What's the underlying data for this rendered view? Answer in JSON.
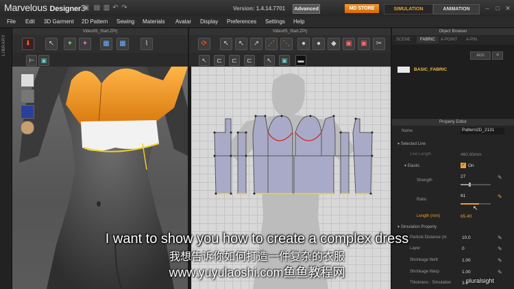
{
  "app": {
    "title_light": "Marvelous",
    "title_bold": "Designer",
    "title_num": "3",
    "version": "Version: 1.4.14.7701",
    "edition": "Advanced",
    "md_store": "MD STORE",
    "simulation": "SIMULATION",
    "animation": "ANIMATION"
  },
  "menu": [
    "File",
    "Edit",
    "3D Garment",
    "2D Pattern",
    "Sewing",
    "Materials",
    "Avatar",
    "Display",
    "Preferences",
    "Settings",
    "Help"
  ],
  "library_label": "LIBRARY",
  "window3d": {
    "title": "Video05_Start.ZPrj"
  },
  "window2d": {
    "title": "Video05_Start.ZPrj"
  },
  "object_browser": {
    "title": "Object Browser",
    "tabs": [
      "SCENE",
      "FABRIC",
      "A-POINT",
      "A-PIN"
    ],
    "active_tab": "FABRIC",
    "add_label": "ADD",
    "fabric_name": "BASIC_FABRIC",
    "fabric_color": "#e8e8e8"
  },
  "property_editor": {
    "title": "Property Editor",
    "name_label": "Name",
    "name_value": "Pattern2D_2131",
    "selected_line": "Selected Line",
    "line_length_label": "Line Length",
    "line_length_value": "460.00mm",
    "elastic_label": "Elastic",
    "elastic_value": "On",
    "strength_label": "Strength",
    "strength_value": "27",
    "strength_fraction": 0.27,
    "ratio_label": "Ratio",
    "ratio_value": "61",
    "ratio_fraction": 0.61,
    "length_label": "Length (mm)",
    "length_value": "65.40",
    "sim_property": "Simulation Property",
    "particle_label": "Particle Distance (m",
    "particle_value": "10.0",
    "layer_label": "Layer",
    "layer_value": "0",
    "shrink_weft_label": "Shrinkage Weft",
    "shrink_weft_value": "1.00",
    "shrink_warp_label": "Shrinkage Warp",
    "shrink_warp_value": "1.00",
    "thickness_label": "Thickness - Simulation",
    "thickness_value": "3.0"
  },
  "subtitles": {
    "english": "I want to show you how to create a complex dress",
    "chinese": "我想告诉你如何打造一件复杂的衣服",
    "url": "www.yuyulaoshi.com鱼鱼教程网"
  },
  "watermark": "pluralsight",
  "colors": {
    "accent_orange": "#f0a030",
    "garment_orange": "#f29a2e",
    "pattern_fill": "#a9aac8",
    "selected_line": "#f0d020"
  }
}
